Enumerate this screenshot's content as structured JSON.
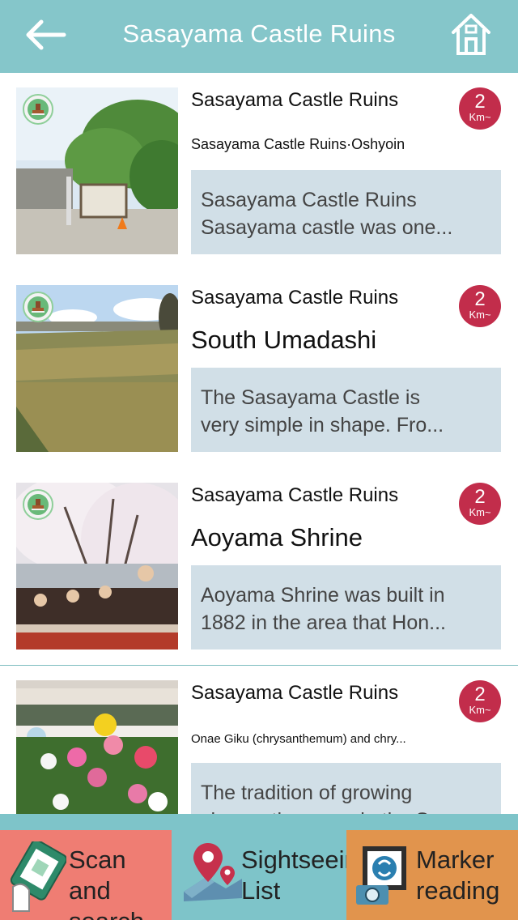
{
  "header": {
    "title": "Sasayama Castle Ruins",
    "back_icon": "back-arrow-icon",
    "home_icon": "home-icon"
  },
  "items": [
    {
      "area": "Sasayama Castle Ruins",
      "name": "Sasayama Castle Ruins·Oshyoin",
      "desc_line1": "Sasayama Castle Ruins",
      "desc_line2": "Sasayama castle was one...",
      "distance_value": "2",
      "distance_unit": "Km~",
      "stamp_icon": "stamp-icon"
    },
    {
      "area": "Sasayama Castle Ruins",
      "name": "South Umadashi",
      "desc_line1": "The Sasayama Castle is",
      "desc_line2": "very simple in shape. Fro...",
      "distance_value": "2",
      "distance_unit": "Km~",
      "stamp_icon": "stamp-icon"
    },
    {
      "area": "Sasayama Castle Ruins",
      "name": "Aoyama Shrine",
      "desc_line1": "Aoyama Shrine was built in",
      "desc_line2": "1882 in the area that Hon...",
      "distance_value": "2",
      "distance_unit": "Km~",
      "stamp_icon": "stamp-icon"
    },
    {
      "area": "Sasayama Castle Ruins",
      "name": "Onae Giku (chrysanthemum) and chry...",
      "desc_line1": "The tradition of growing",
      "desc_line2": "chrysanthemums in the S...",
      "distance_value": "2",
      "distance_unit": "Km~"
    }
  ],
  "bottom_nav": {
    "scan_line1": "Scan and",
    "scan_line2": "search",
    "list_line1": "Sightseeing",
    "list_line2": "List",
    "marker_line1": "Marker",
    "marker_line2": "reading"
  },
  "colors": {
    "header": "#85c6ca",
    "distance_badge": "#c22d4b",
    "description_bg": "#d1dfe7",
    "scan_button": "#ef7d73",
    "list_button": "#7ec4c9",
    "marker_button": "#e1944d"
  }
}
